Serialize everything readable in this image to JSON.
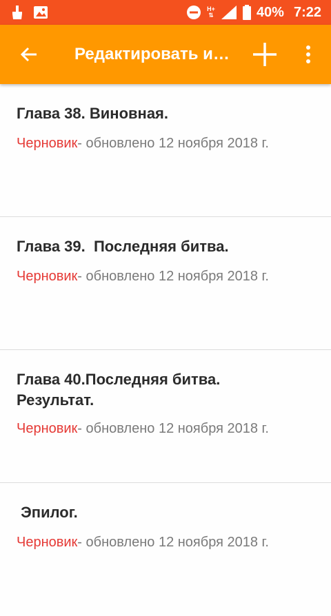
{
  "status_bar": {
    "battery": "40%",
    "time": "7:22",
    "network": "H+"
  },
  "toolbar": {
    "title": "Редактировать ис..."
  },
  "chapters": [
    {
      "title": "Глава 38. Виновная.",
      "status": "Черновик",
      "updated": "- обновлено 12 ноября 2018 г."
    },
    {
      "title": "Глава 39.  Последняя битва.",
      "status": "Черновик",
      "updated": "- обновлено 12 ноября 2018 г."
    },
    {
      "title": "Глава 40.Последняя битва. Результат.",
      "status": "Черновик",
      "updated": "- обновлено 12 ноября 2018 г."
    },
    {
      "title": " Эпилог.",
      "status": "Черновик",
      "updated": "- обновлено 12 ноября 2018 г."
    }
  ],
  "colors": {
    "status_bar": "#f4511e",
    "toolbar": "#ff9800",
    "draft": "#e53935"
  }
}
